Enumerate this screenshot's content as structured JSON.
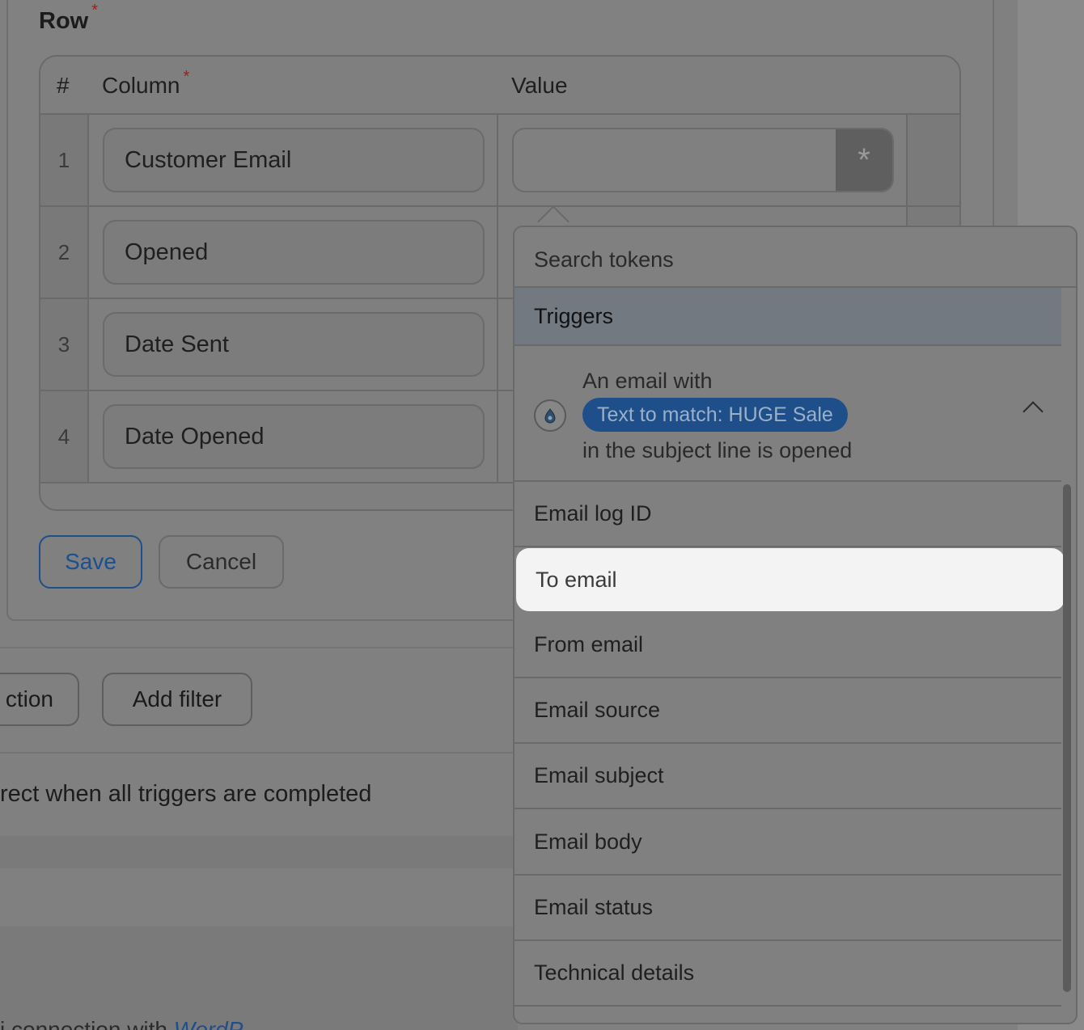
{
  "form": {
    "row_label": "Row",
    "required_mark": "*",
    "table": {
      "headers": {
        "hash": "#",
        "column": "Column",
        "value": "Value"
      },
      "rows": [
        {
          "num": "1",
          "column": "Customer Email"
        },
        {
          "num": "2",
          "column": "Opened"
        },
        {
          "num": "3",
          "column": "Date Sent"
        },
        {
          "num": "4",
          "column": "Date Opened"
        }
      ],
      "token_button": "*"
    },
    "save_label": "Save",
    "cancel_label": "Cancel"
  },
  "below": {
    "action_label": "ction",
    "filter_label": "Add filter",
    "trigger_text": "rect when all triggers are completed",
    "footer_text": "i connection with ",
    "footer_link": "WordP"
  },
  "dropdown": {
    "search_placeholder": "Search tokens",
    "group_label": "Triggers",
    "trigger": {
      "line1": "An email with",
      "badge": "Text to match: HUGE Sale",
      "line3": "in the subject line is opened"
    },
    "items": [
      "Email log ID",
      "To email",
      "From email",
      "Email source",
      "Email subject",
      "Email body",
      "Email status",
      "Technical details"
    ],
    "highlighted_index": 1
  }
}
